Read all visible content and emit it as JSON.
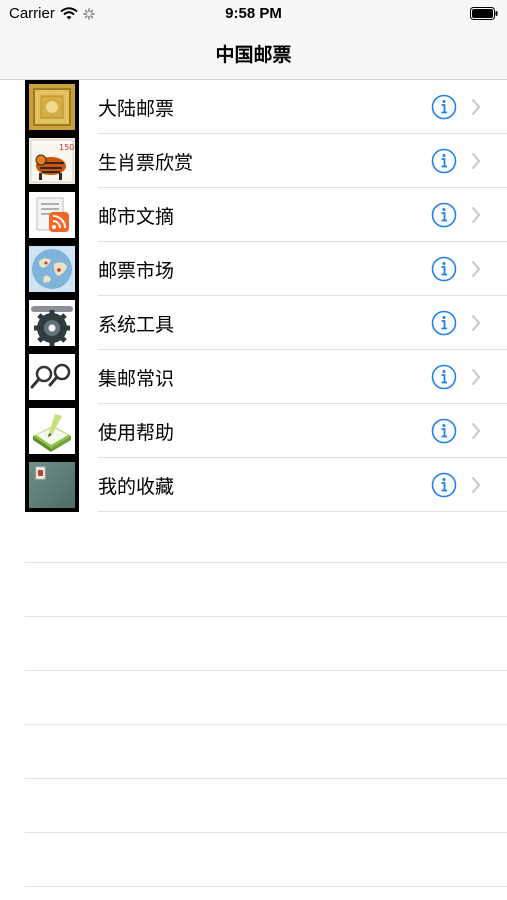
{
  "status_bar": {
    "carrier": "Carrier",
    "time": "9:58 PM"
  },
  "nav": {
    "title": "中国邮票"
  },
  "rows": [
    {
      "label": "大陆邮票",
      "thumb": "stamp-gold"
    },
    {
      "label": "生肖票欣赏",
      "thumb": "stamp-tiger"
    },
    {
      "label": "邮市文摘",
      "thumb": "rss-feed"
    },
    {
      "label": "邮票市场",
      "thumb": "globe-map"
    },
    {
      "label": "系统工具",
      "thumb": "gear-tools"
    },
    {
      "label": "集邮常识",
      "thumb": "magnifier-tongs"
    },
    {
      "label": "使用帮助",
      "thumb": "help-book"
    },
    {
      "label": "我的收藏",
      "thumb": "album"
    }
  ],
  "colors": {
    "accent": "#1f7ff5",
    "chevron": "#c7c7cc",
    "bar_background": "#f7f7f7"
  }
}
